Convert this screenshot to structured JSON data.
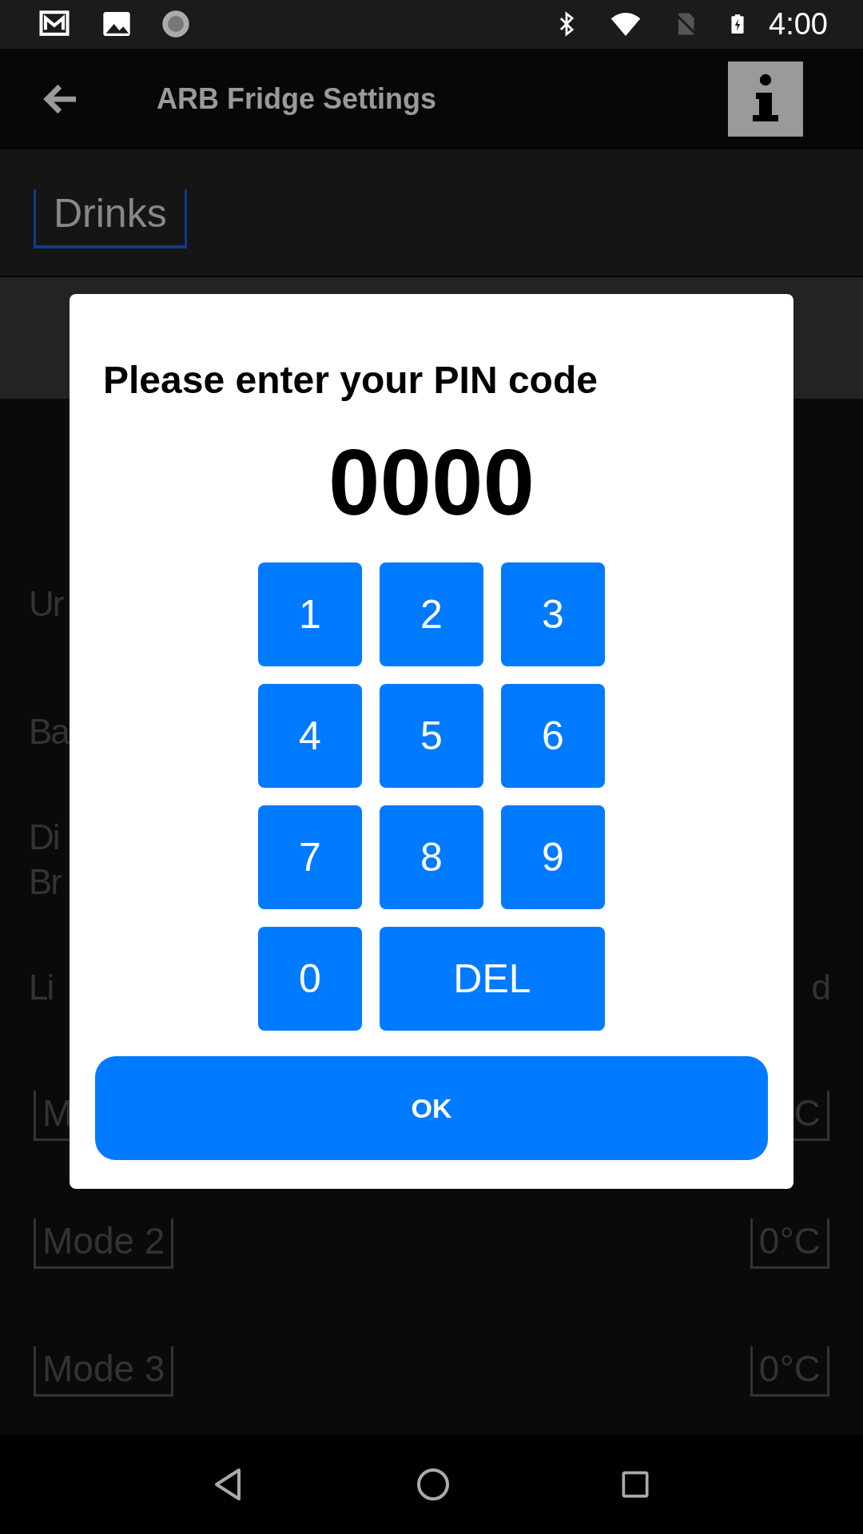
{
  "status_bar": {
    "time": "4:00"
  },
  "app_bar": {
    "title": "ARB Fridge Settings"
  },
  "tabs": [
    {
      "label": "Drinks",
      "selected": true
    }
  ],
  "settings": [
    {
      "kind": "plain",
      "lines": [
        "Ur"
      ]
    },
    {
      "kind": "plain",
      "lines": [
        "Ba"
      ]
    },
    {
      "kind": "plain",
      "lines": [
        "Di",
        "Br"
      ]
    },
    {
      "kind": "plain",
      "lines": [
        "Li"
      ],
      "value": "d"
    },
    {
      "kind": "field",
      "lines": [
        "M"
      ],
      "value": "C"
    },
    {
      "kind": "field",
      "lines": [
        "Mode 2"
      ],
      "value": "0°C"
    },
    {
      "kind": "field",
      "lines": [
        "Mode 3"
      ],
      "value": "0°C"
    }
  ],
  "pin_dialog": {
    "title": "Please enter your PIN code",
    "pin": "0000",
    "keys": [
      {
        "label": "1",
        "kind": "digit"
      },
      {
        "label": "2",
        "kind": "digit"
      },
      {
        "label": "3",
        "kind": "digit"
      },
      {
        "label": "4",
        "kind": "digit"
      },
      {
        "label": "5",
        "kind": "digit"
      },
      {
        "label": "6",
        "kind": "digit"
      },
      {
        "label": "7",
        "kind": "digit"
      },
      {
        "label": "8",
        "kind": "digit"
      },
      {
        "label": "9",
        "kind": "digit"
      },
      {
        "label": "0",
        "kind": "digit"
      },
      {
        "label": "DEL",
        "kind": "wide"
      }
    ],
    "confirm": "OK"
  }
}
